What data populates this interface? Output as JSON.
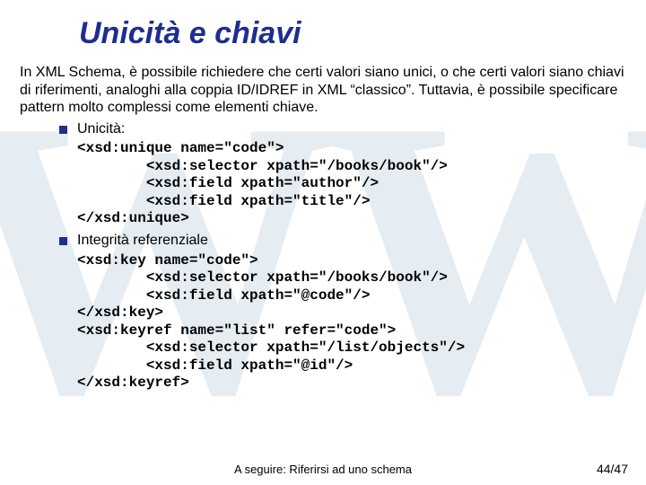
{
  "watermark": "WW",
  "title": "Unicità e chiavi",
  "intro": "In XML Schema, è possibile richiedere che certi valori siano unici, o che certi valori siano chiavi di riferimenti, analoghi alla coppia ID/IDREF in XML “classico”. Tuttavia, è possibile specificare pattern molto complessi come elementi chiave.",
  "bullets": [
    {
      "label": "Unicità:",
      "code": "<xsd:unique name=\"code\">\n        <xsd:selector xpath=\"/books/book\"/>\n        <xsd:field xpath=\"author\"/>\n        <xsd:field xpath=\"title\"/>\n</xsd:unique>"
    },
    {
      "label": "Integrità referenziale",
      "code": "<xsd:key name=\"code\">\n        <xsd:selector xpath=\"/books/book\"/>\n        <xsd:field xpath=\"@code\"/>\n</xsd:key>\n<xsd:keyref name=\"list\" refer=\"code\">\n        <xsd:selector xpath=\"/list/objects\"/>\n        <xsd:field xpath=\"@id\"/>\n</xsd:keyref>"
    }
  ],
  "footer": {
    "next": "A seguire: Riferirsi ad uno schema",
    "page": "44/47"
  }
}
